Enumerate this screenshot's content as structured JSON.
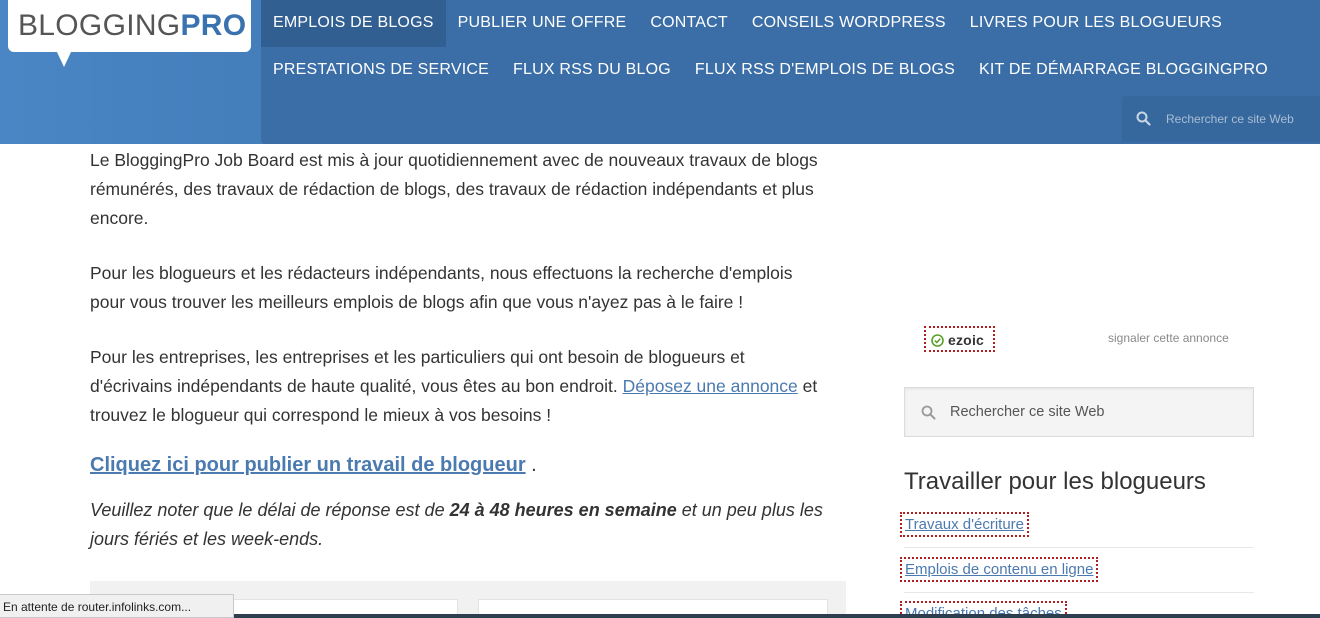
{
  "brand": {
    "logo_part1": "BLOGGING",
    "logo_part2": "PRO",
    "color_primary": "#3b6ea6",
    "color_link": "#4b7ab0"
  },
  "nav": {
    "row1": [
      "EMPLOIS DE BLOGS",
      "PUBLIER UNE OFFRE",
      "CONTACT",
      "CONSEILS WORDPRESS",
      "LIVRES POUR LES BLOGUEURS"
    ],
    "row2": [
      "PRESTATIONS DE SERVICE",
      "FLUX RSS DU BLOG",
      "FLUX RSS D'EMPLOIS DE BLOGS",
      "KIT DE DÉMARRAGE BLOGGINGPRO"
    ],
    "active_index": 0,
    "search_placeholder": "Rechercher ce site Web"
  },
  "main": {
    "p1_line1": "Le BloggingPro Job Board est mis à jour quotidiennement avec de nouveaux travaux de blogs",
    "p1_line2": "rémunérés, des travaux de rédaction de blogs, des travaux de rédaction indépendants et plus",
    "p1_line3": "encore.",
    "p2_line1": "Pour les blogueurs et les rédacteurs indépendants, nous effectuons la recherche d'emplois",
    "p2_line2": "pour vous trouver les meilleurs emplois de blogs afin que vous n'ayez pas à le faire !",
    "p3_line1": "Pour les entreprises, les entreprises et les particuliers qui ont besoin de blogueurs et",
    "p3_line2_before": "d'écrivains indépendants de haute qualité, vous êtes au bon endroit.",
    "p3_link": "Déposez une annonce",
    "p3_line2_after": "et",
    "p3_line3": "trouvez le blogueur qui correspond le mieux à vos besoins !",
    "cta_link": "Cliquez ici pour publier un travail de blogueur",
    "cta_suffix": ".",
    "note_before": "Veuillez noter que le délai de réponse est de",
    "note_bold": "24 à 48 heures en semaine",
    "note_after": " et un peu plus les",
    "note_line2": "jours fériés et les week-ends."
  },
  "sidebar": {
    "ad_brand": "ezoic",
    "ad_report": "signaler cette annonce",
    "search_placeholder": "Rechercher ce site Web",
    "title": "Travailler pour les blogueurs",
    "links": [
      "Travaux d'écriture",
      "Emplois de contenu en ligne",
      "Modification des tâches"
    ]
  },
  "status_bar": {
    "text": "En attente de router.infolinks.com..."
  }
}
